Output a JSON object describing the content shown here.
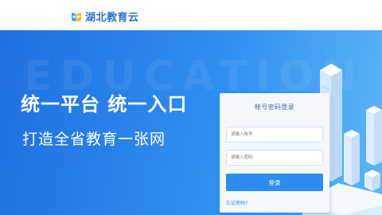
{
  "header": {
    "site_name": "湖北教育云"
  },
  "hero": {
    "watermark": "EDUCATION",
    "headline": "统一平台  统一入口",
    "subline": "打造全省教育一张网"
  },
  "login": {
    "title": "帐号密码登录",
    "username_placeholder": "请输入帐号",
    "password_placeholder": "请输入密码",
    "submit_label": "登录",
    "forgot_label": "忘记密码?"
  },
  "colors": {
    "brand": "#2a6fd6",
    "hero_start": "#1f6fe0",
    "hero_end": "#5cb6f7",
    "button": "#2d8cf0"
  },
  "icons": {
    "logo": "book-cloud-icon"
  }
}
